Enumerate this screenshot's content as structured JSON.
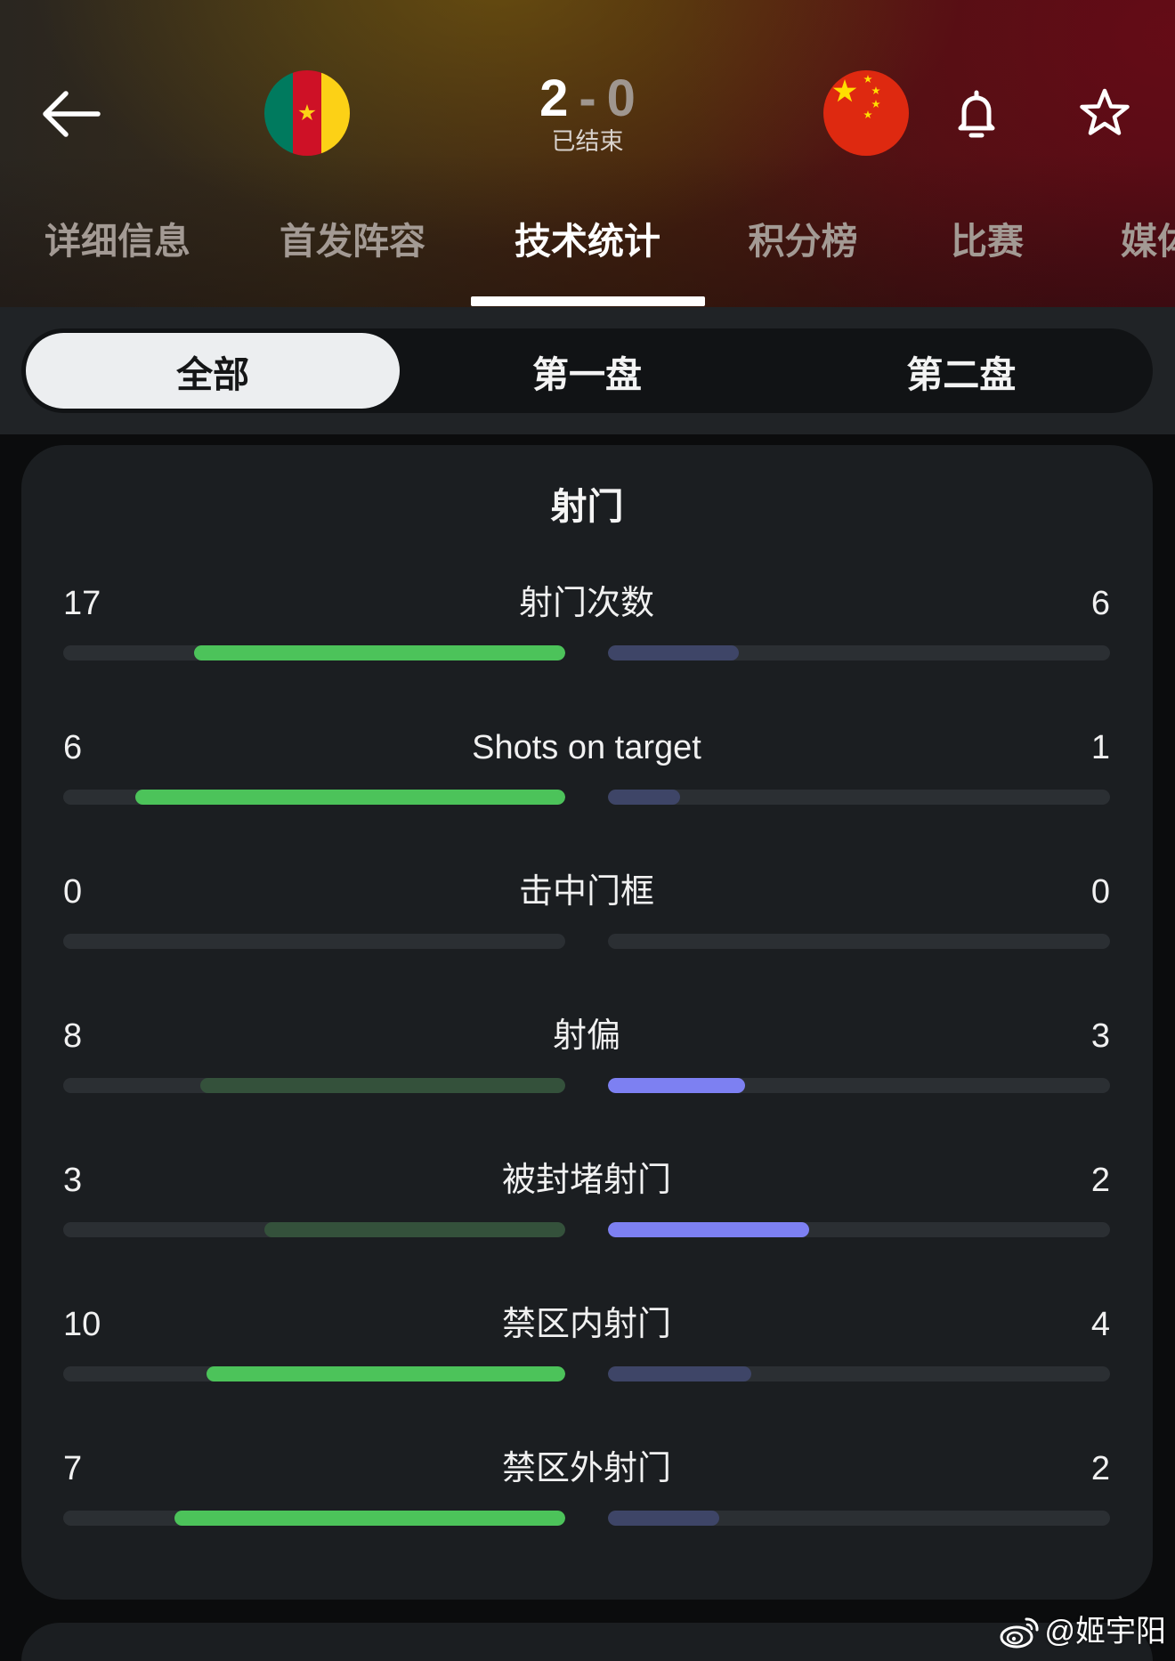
{
  "header": {
    "back_icon": "arrow-left-icon",
    "home": {
      "flag_icon": "cameroon-flag-icon",
      "score": "2"
    },
    "separator": "-",
    "away": {
      "flag_icon": "china-flag-icon",
      "score": "0"
    },
    "status": "已结束",
    "bell_icon": "bell-icon",
    "star_icon": "star-icon"
  },
  "tabs": [
    {
      "label": "详细信息",
      "active": false
    },
    {
      "label": "首发阵容",
      "active": false
    },
    {
      "label": "技术统计",
      "active": true
    },
    {
      "label": "积分榜",
      "active": false
    },
    {
      "label": "比赛",
      "active": false
    },
    {
      "label": "媒体",
      "active": false
    }
  ],
  "period_filter": {
    "options": [
      "全部",
      "第一盘",
      "第二盘"
    ],
    "selected": "全部"
  },
  "shots_section": {
    "title": "射门",
    "stats": [
      {
        "label": "射门次数",
        "home": 17,
        "away": 6,
        "highlight": "home"
      },
      {
        "label": "Shots on target",
        "home": 6,
        "away": 1,
        "highlight": "home"
      },
      {
        "label": "击中门框",
        "home": 0,
        "away": 0,
        "highlight": "none"
      },
      {
        "label": "射偏",
        "home": 8,
        "away": 3,
        "highlight": "away"
      },
      {
        "label": "被封堵射门",
        "home": 3,
        "away": 2,
        "highlight": "away"
      },
      {
        "label": "禁区内射门",
        "home": 10,
        "away": 4,
        "highlight": "home"
      },
      {
        "label": "禁区外射门",
        "home": 7,
        "away": 2,
        "highlight": "home"
      }
    ]
  },
  "colors": {
    "home_highlight": "#4cc35a",
    "home_muted": "#34513b",
    "away_highlight": "#7d80f2",
    "away_muted": "#3e4567",
    "bar_track": "#2b2f33"
  },
  "watermark": {
    "icon": "weibo-icon",
    "text": "@姬宇阳"
  }
}
